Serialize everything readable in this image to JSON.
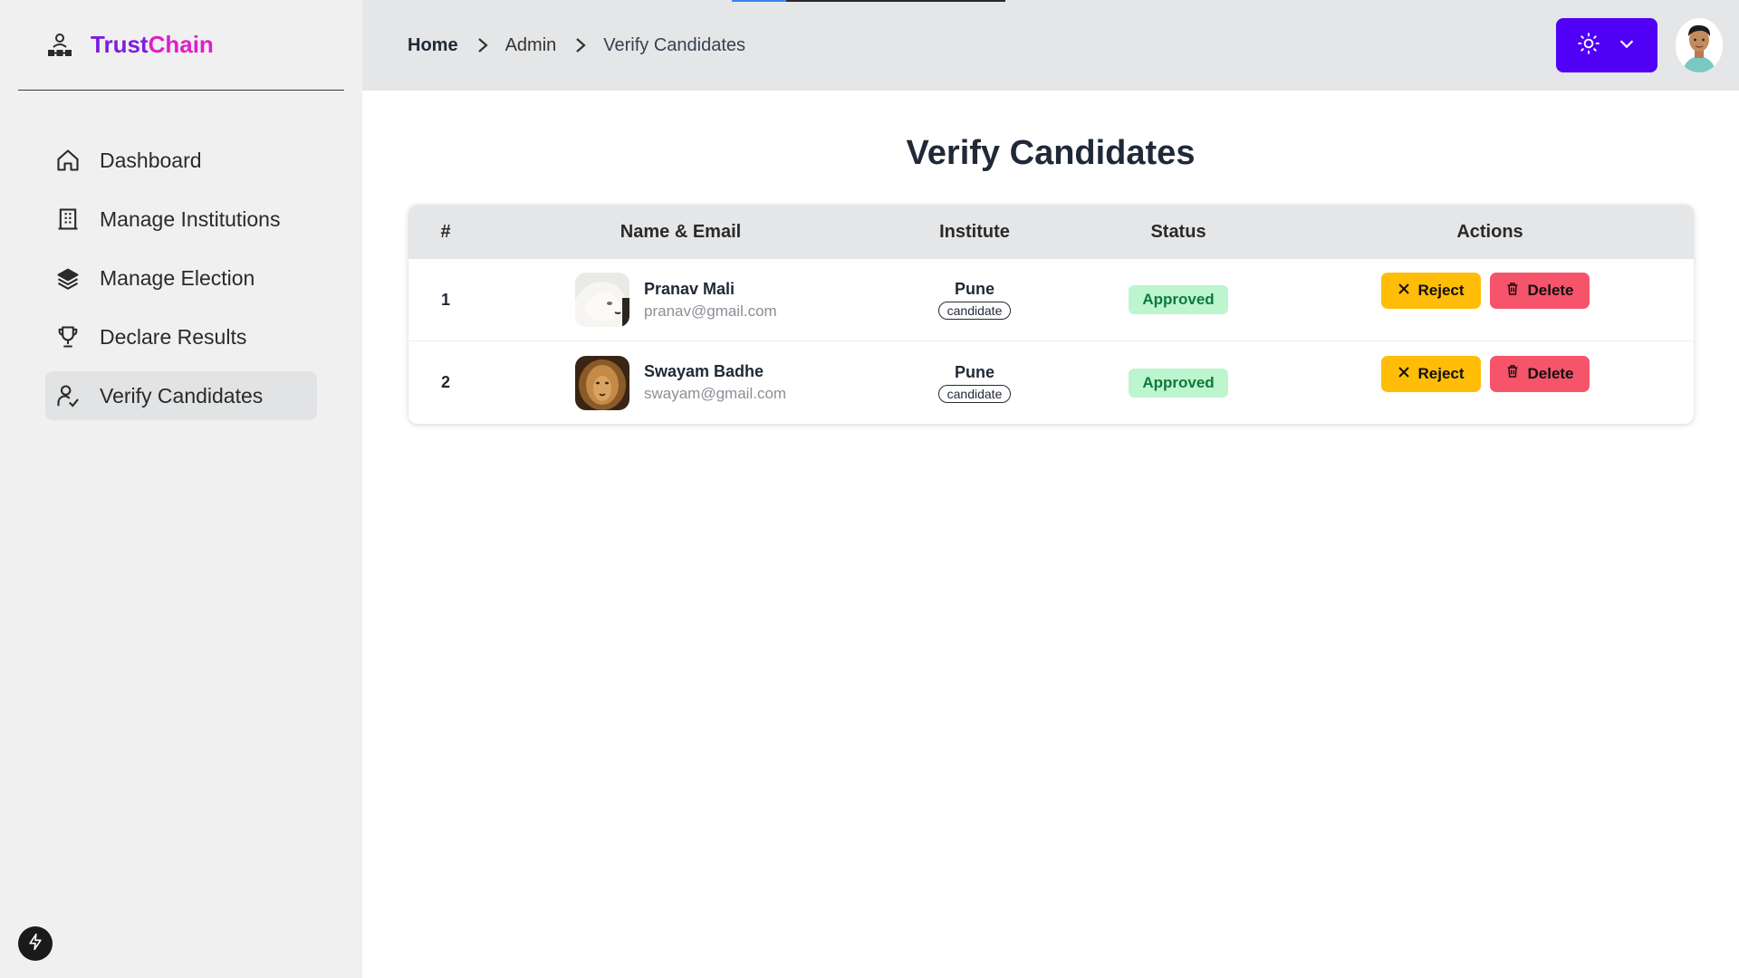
{
  "app": {
    "brand_part1": "Trust",
    "brand_part2": "Chain"
  },
  "sidebar": {
    "items": [
      {
        "label": "Dashboard",
        "icon": "home-icon",
        "active": false
      },
      {
        "label": "Manage Institutions",
        "icon": "building-icon",
        "active": false
      },
      {
        "label": "Manage Election",
        "icon": "layers-icon",
        "active": false
      },
      {
        "label": "Declare Results",
        "icon": "trophy-icon",
        "active": false
      },
      {
        "label": "Verify Candidates",
        "icon": "user-check-icon",
        "active": true
      }
    ]
  },
  "breadcrumb": {
    "home": "Home",
    "admin": "Admin",
    "current": "Verify Candidates"
  },
  "page": {
    "title": "Verify Candidates"
  },
  "table": {
    "headers": {
      "num": "#",
      "name": "Name & Email",
      "institute": "Institute",
      "status": "Status",
      "actions": "Actions"
    },
    "rows": [
      {
        "num": "1",
        "name": "Pranav Mali",
        "email": "pranav@gmail.com",
        "institute": "Pune",
        "role": "candidate",
        "status": "Approved",
        "reject": "Reject",
        "delete": "Delete"
      },
      {
        "num": "2",
        "name": "Swayam Badhe",
        "email": "swayam@gmail.com",
        "institute": "Pune",
        "role": "candidate",
        "status": "Approved",
        "reject": "Reject",
        "delete": "Delete"
      }
    ]
  },
  "colors": {
    "accent": "#4f00f5",
    "brand_a": "#7c1ee0",
    "brand_b": "#e01ec8",
    "approved_bg": "#bdf5cf",
    "reject": "#ffbd08",
    "delete": "#f5546a"
  }
}
